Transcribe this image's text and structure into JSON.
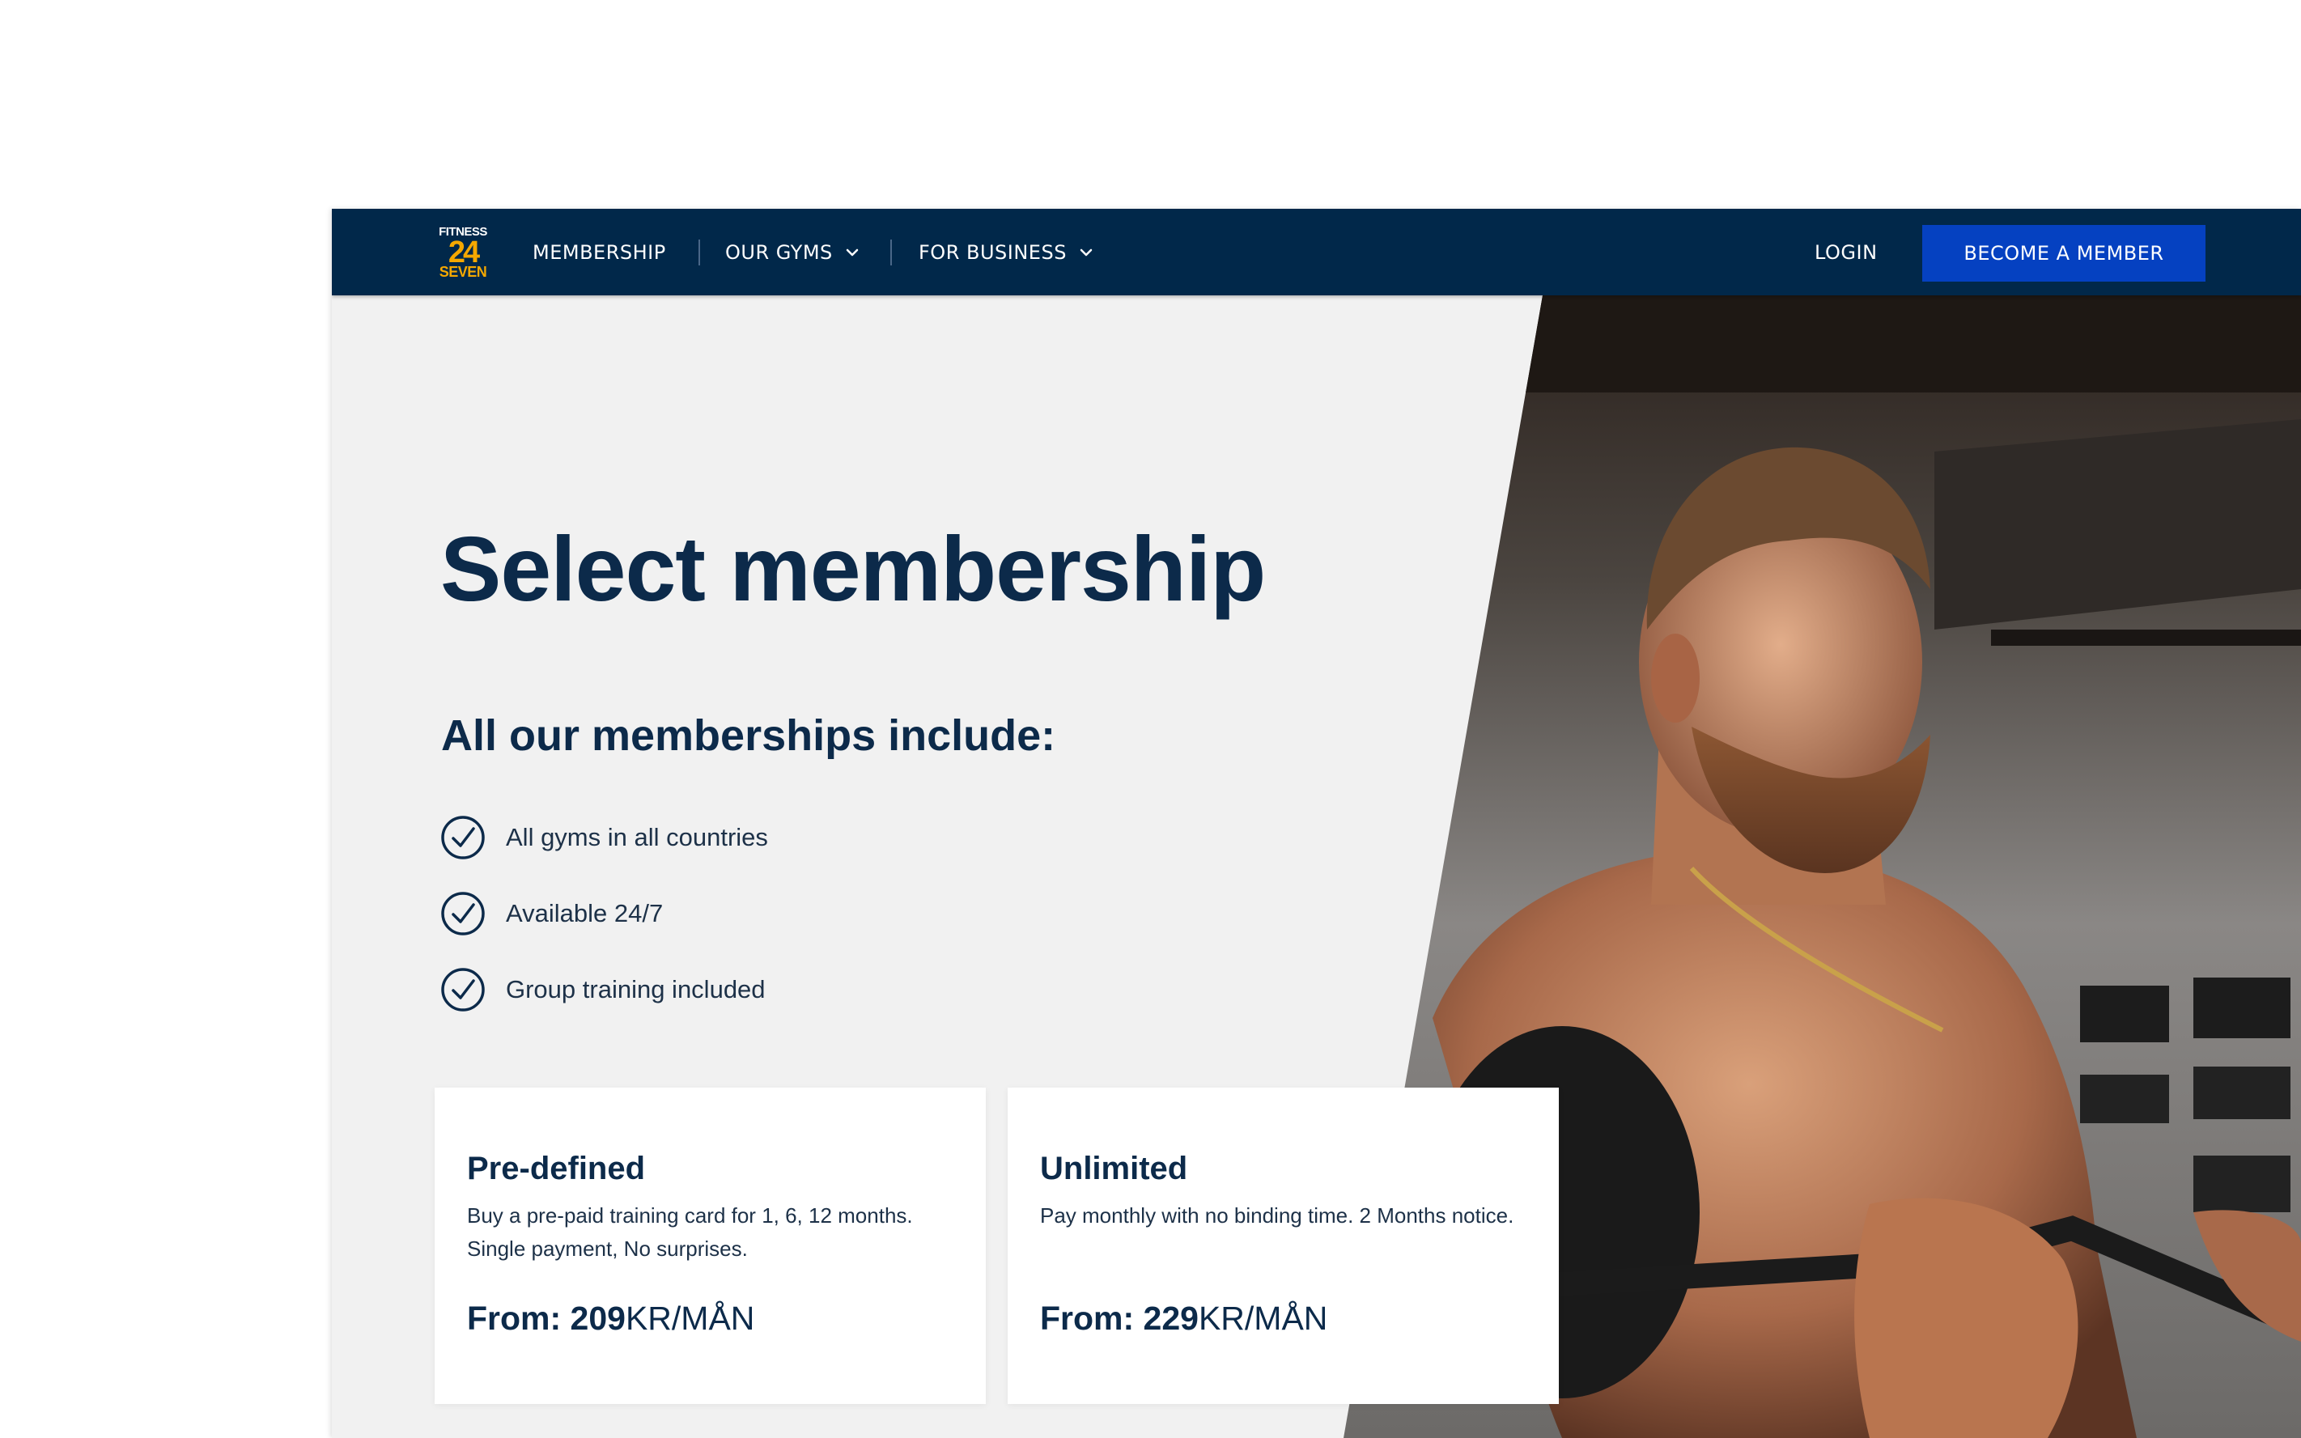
{
  "brand": {
    "line1": "FITNESS",
    "line2": "24",
    "line3": "SEVEN",
    "accent": "#f5a800",
    "navy": "#01284a",
    "cta_blue": "#0541c1"
  },
  "nav": {
    "membership": "MEMBERSHIP",
    "gyms": "OUR GYMS",
    "business": "FOR BUSINESS",
    "login": "LOGIN",
    "cta": "BECOME A MEMBER"
  },
  "hero": {
    "title": "Select membership",
    "subtitle": "All our memberships include:",
    "features": [
      "All gyms in all countries",
      "Available 24/7",
      "Group training included"
    ],
    "image_alt": "man-lifting-barbell-photo"
  },
  "cards": [
    {
      "title": "Pre-defined",
      "description": "Buy a pre-paid training card for 1, 6, 12 months. Single payment, No surprises.",
      "price_prefix": "From: 209",
      "price_unit": "KR/MÅN"
    },
    {
      "title": "Unlimited",
      "description": "Pay monthly with no binding time. 2 Months notice.",
      "price_prefix": "From: 229",
      "price_unit": "KR/MÅN"
    }
  ],
  "icons": {
    "check": "check-circle-icon",
    "chevron": "chevron-down-icon"
  }
}
